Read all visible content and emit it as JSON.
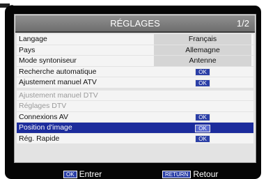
{
  "menu": {
    "title": "RÉGLAGES",
    "page": "1/2",
    "items": [
      {
        "label": "Langage",
        "value": "Français"
      },
      {
        "label": "Pays",
        "value": "Allemagne"
      },
      {
        "label": "Mode syntoniseur",
        "value": "Antenne"
      },
      {
        "label": "Recherche automatique",
        "value": "OK"
      },
      {
        "label": "Ajustement manuel ATV",
        "value": "OK"
      },
      {
        "label": "Ajustement manuel DTV",
        "value": ""
      },
      {
        "label": "Réglages DTV",
        "value": ""
      },
      {
        "label": "Connexions AV",
        "value": "OK"
      },
      {
        "label": "Position d'image",
        "value": "OK"
      },
      {
        "label": "Rég. Rapide",
        "value": "OK"
      }
    ]
  },
  "footer": {
    "ok_key": "OK",
    "ok_label": "Entrer",
    "return_key": "RETURN",
    "return_label": "Retour"
  },
  "colors": {
    "selected_row": "#1c2c9c",
    "accent_button": "#2b3fa6"
  }
}
